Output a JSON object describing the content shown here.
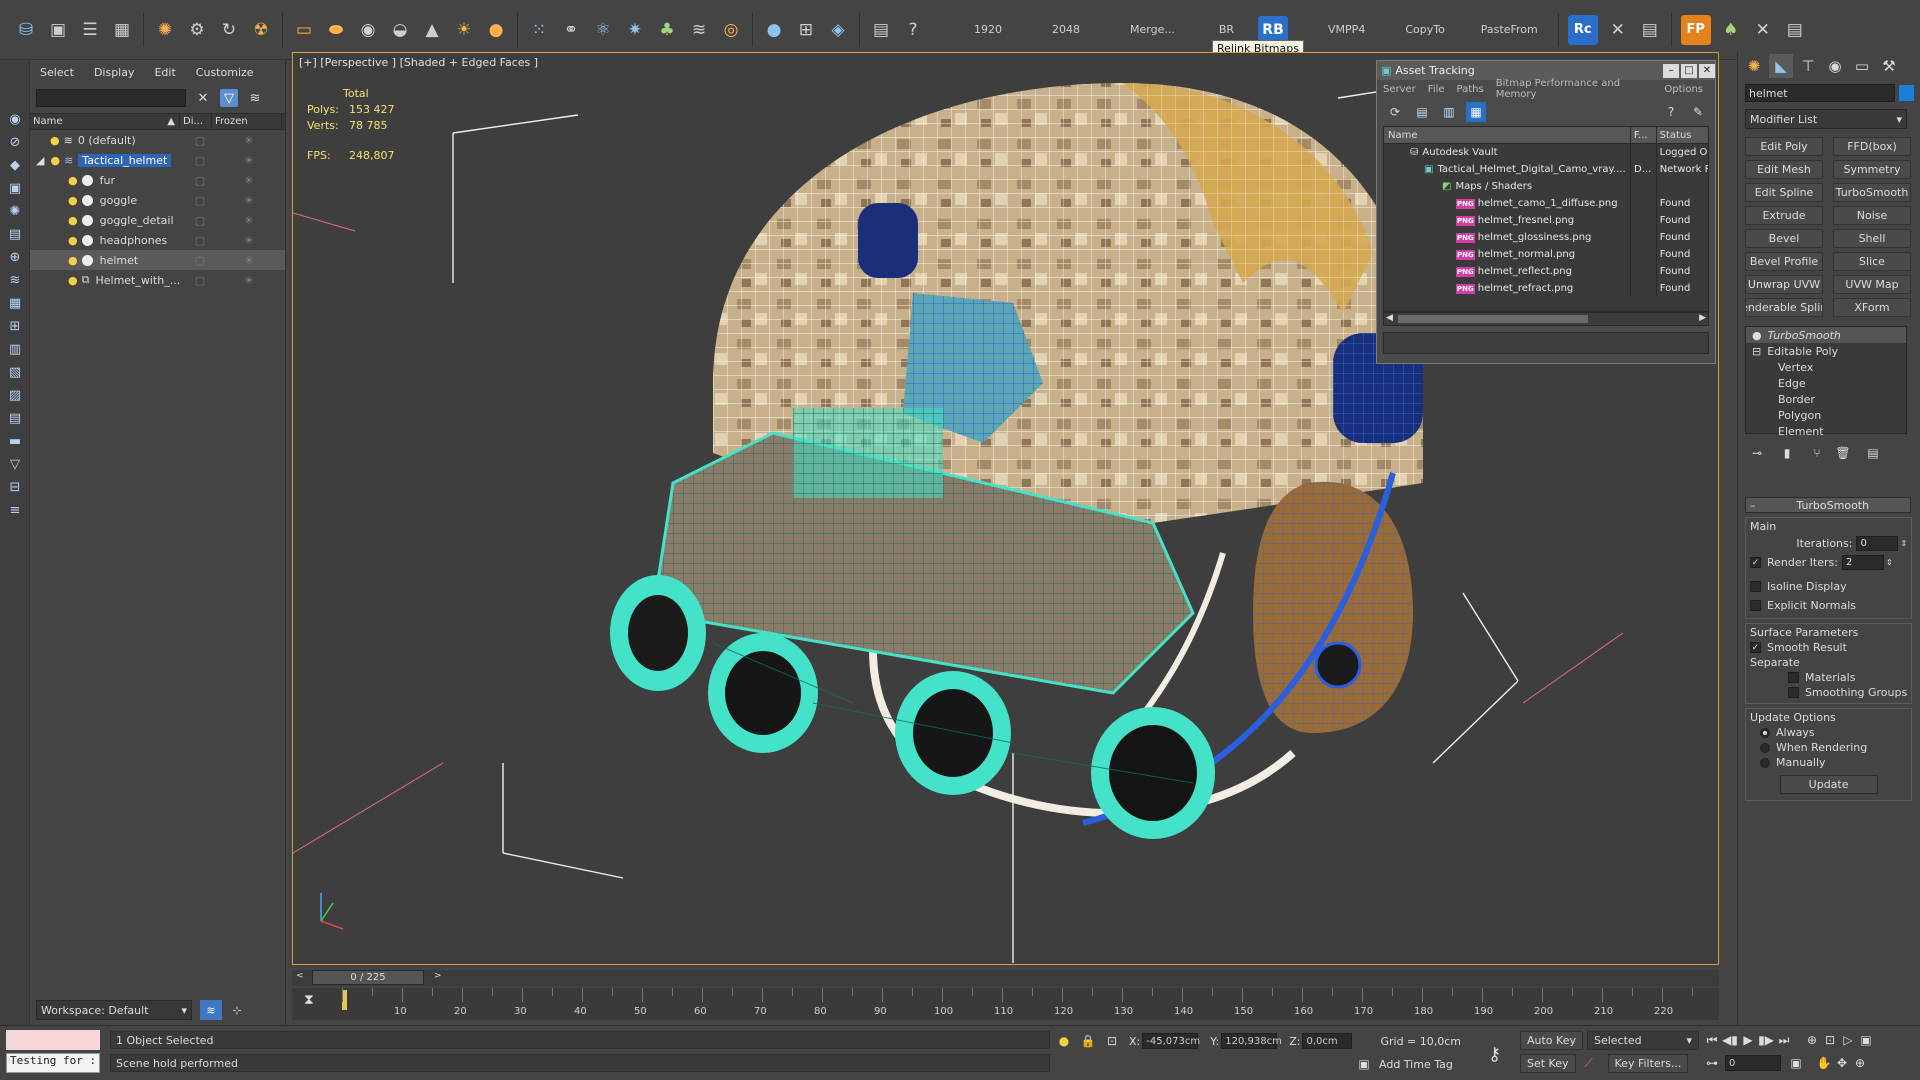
{
  "toolbar": {
    "texts": [
      "1920",
      "2048",
      "Merge...",
      "BR"
    ],
    "rb_label": "RB",
    "texts2": [
      "VMPP4",
      "CopyTo",
      "PasteFrom"
    ],
    "tile_rc": "Rc",
    "tile_fp": "FP",
    "tooltip": "Relink Bitmaps"
  },
  "explorer": {
    "menu": [
      "Select",
      "Display",
      "Edit",
      "Customize"
    ],
    "columns": {
      "name": "Name",
      "display": "Di...",
      "frozen": "Frozen"
    },
    "rows": [
      {
        "label": "0 (default)"
      },
      {
        "label": "Tactical_helmet"
      },
      {
        "label": "fur"
      },
      {
        "label": "goggle"
      },
      {
        "label": "goggle_detail"
      },
      {
        "label": "headphones"
      },
      {
        "label": "helmet"
      },
      {
        "label": "Helmet_with_..."
      }
    ],
    "workspace": "Workspace: Default"
  },
  "viewport": {
    "label": "[+] [Perspective ] [Shaded + Edged Faces ]",
    "stats": {
      "total_label": "Total",
      "polys_label": "Polys:",
      "polys": "153 427",
      "verts_label": "Verts:",
      "verts": "78 785",
      "fps_label": "FPS:",
      "fps": "248,807"
    }
  },
  "asset_tracking": {
    "title": "Asset Tracking",
    "menu": [
      "Server",
      "File",
      "Paths",
      "Bitmap Performance and Memory",
      "Options"
    ],
    "columns": {
      "name": "Name",
      "f": "F...",
      "status": "Status"
    },
    "rows": [
      {
        "name": "Autodesk Vault",
        "f": "",
        "status": "Logged Ou"
      },
      {
        "name": "Tactical_Helmet_Digital_Camo_vray....",
        "f": "D...",
        "status": "Network P"
      },
      {
        "name": "Maps / Shaders",
        "f": "",
        "status": ""
      },
      {
        "name": "helmet_camo_1_diffuse.png",
        "f": "",
        "status": "Found"
      },
      {
        "name": "helmet_fresnel.png",
        "f": "",
        "status": "Found"
      },
      {
        "name": "helmet_glossiness.png",
        "f": "",
        "status": "Found"
      },
      {
        "name": "helmet_normal.png",
        "f": "",
        "status": "Found"
      },
      {
        "name": "helmet_reflect.png",
        "f": "",
        "status": "Found"
      },
      {
        "name": "helmet_refract.png",
        "f": "",
        "status": "Found"
      }
    ]
  },
  "command_panel": {
    "object_name": "helmet",
    "modifier_list": "Modifier List",
    "buttons": [
      [
        "Edit Poly",
        "FFD(box)"
      ],
      [
        "Edit Mesh",
        "Symmetry"
      ],
      [
        "Edit Spline",
        "TurboSmooth"
      ],
      [
        "Extrude",
        "Noise"
      ],
      [
        "Bevel",
        "Shell"
      ],
      [
        "Bevel Profile",
        "Slice"
      ],
      [
        "Unwrap UVW",
        "UVW Map"
      ],
      [
        "Renderable Spline",
        "XForm"
      ]
    ],
    "stack": {
      "top": "TurboSmooth",
      "base": "Editable Poly",
      "subobjects": [
        "Vertex",
        "Edge",
        "Border",
        "Polygon",
        "Element"
      ]
    },
    "turbosmooth": {
      "title": "TurboSmooth",
      "main": "Main",
      "iterations_label": "Iterations:",
      "iterations": "0",
      "render_iters_label": "Render Iters:",
      "render_iters": "2",
      "isoline": "Isoline Display",
      "explicit_normals": "Explicit Normals",
      "surface_params": "Surface Parameters",
      "smooth_result": "Smooth Result",
      "separate": "Separate",
      "materials": "Materials",
      "smoothing_groups": "Smoothing Groups",
      "update_options": "Update Options",
      "always": "Always",
      "when_rendering": "When Rendering",
      "manually": "Manually",
      "update": "Update"
    }
  },
  "timeline": {
    "frame": "0 / 225",
    "ticks": [
      "10",
      "20",
      "30",
      "40",
      "50",
      "60",
      "70",
      "80",
      "90",
      "100",
      "110",
      "120",
      "130",
      "140",
      "150",
      "160",
      "170",
      "180",
      "190",
      "200",
      "210",
      "220"
    ]
  },
  "status": {
    "maxscript": "Testing for :",
    "selected": "1 Object Selected",
    "prompt": "Scene hold performed",
    "x_label": "X:",
    "x": "-45,073cm",
    "y_label": "Y:",
    "y": "120,938cm",
    "z_label": "Z:",
    "z": "0,0cm",
    "grid": "Grid = 10,0cm",
    "add_time_tag": "Add Time Tag",
    "auto_key": "Auto Key",
    "set_key": "Set Key",
    "selected_dropdown": "Selected",
    "key_filters": "Key Filters...",
    "frame_field": "0"
  }
}
